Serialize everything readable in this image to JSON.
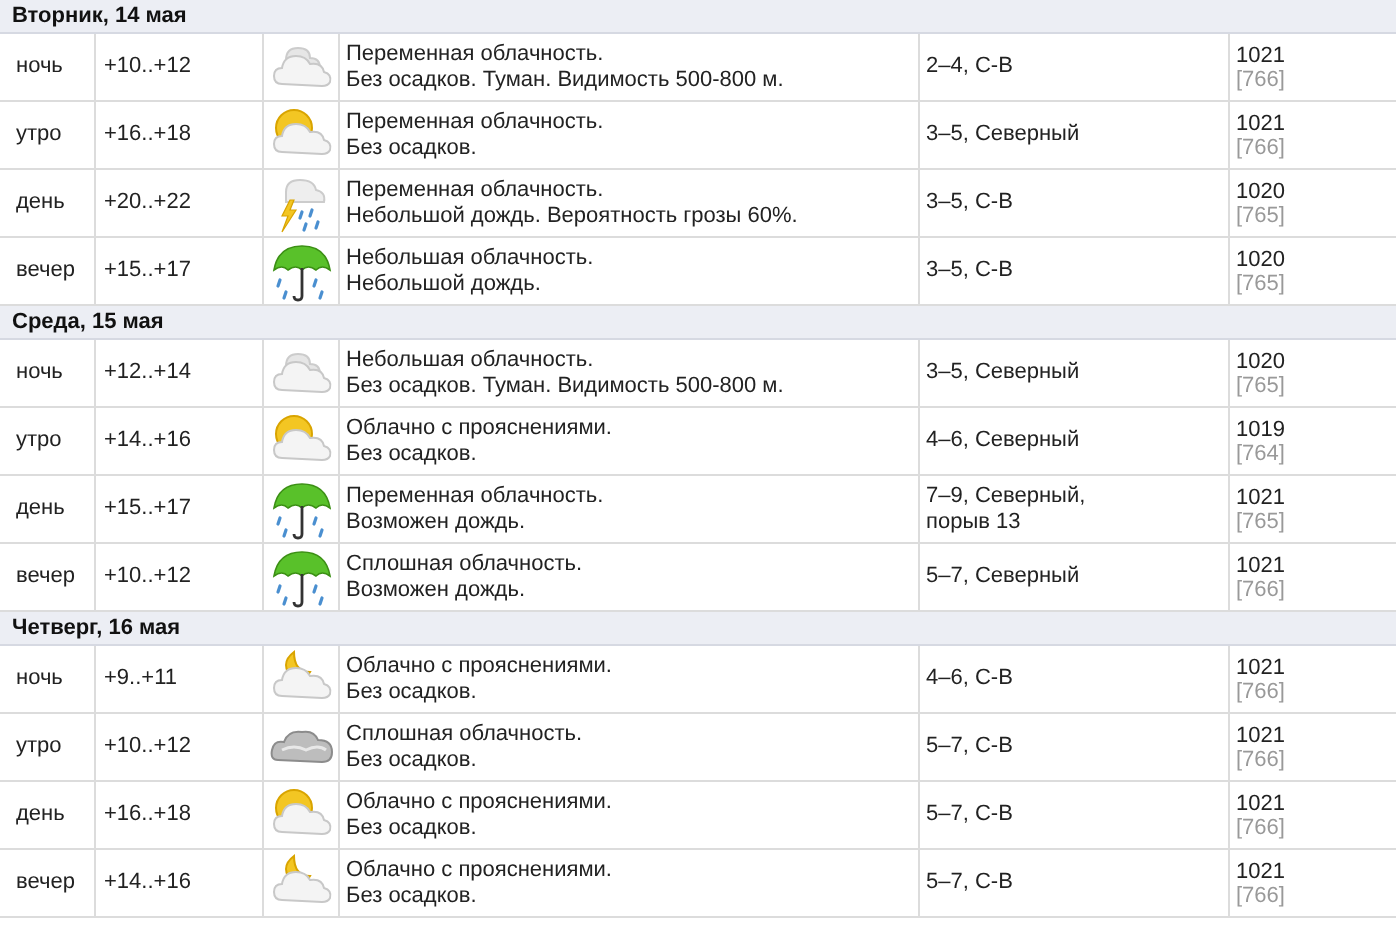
{
  "days": [
    {
      "title": "Вторник, 14 мая",
      "rows": [
        {
          "part": "ночь",
          "temp": "+10..+12",
          "kind": "cloudy",
          "cond": "Переменная облачность.",
          "precip": "Без осадков. Туман. Видимость 500-800 м.",
          "wind": "2–4, С-В",
          "pressure": "1021",
          "mmhg": "[766]"
        },
        {
          "part": "утро",
          "temp": "+16..+18",
          "kind": "sunny",
          "cond": "Переменная облачность.",
          "precip": "Без осадков.",
          "wind": "3–5, Северный",
          "pressure": "1021",
          "mmhg": "[766]"
        },
        {
          "part": "день",
          "temp": "+20..+22",
          "kind": "storm",
          "cond": "Переменная облачность.",
          "precip": "Небольшой дождь. Вероятность грозы 60%.",
          "wind": "3–5, С-В",
          "pressure": "1020",
          "mmhg": "[765]"
        },
        {
          "part": "вечер",
          "temp": "+15..+17",
          "kind": "rain",
          "cond": "Небольшая облачность.",
          "precip": "Небольшой дождь.",
          "wind": "3–5, С-В",
          "pressure": "1020",
          "mmhg": "[765]"
        }
      ]
    },
    {
      "title": "Среда, 15 мая",
      "rows": [
        {
          "part": "ночь",
          "temp": "+12..+14",
          "kind": "cloudy",
          "cond": "Небольшая облачность.",
          "precip": "Без осадков. Туман. Видимость 500-800 м.",
          "wind": "3–5, Северный",
          "pressure": "1020",
          "mmhg": "[765]"
        },
        {
          "part": "утро",
          "temp": "+14..+16",
          "kind": "sunny",
          "cond": "Облачно с прояснениями.",
          "precip": "Без осадков.",
          "wind": "4–6, Северный",
          "pressure": "1019",
          "mmhg": "[764]"
        },
        {
          "part": "день",
          "temp": "+15..+17",
          "kind": "rain",
          "cond": "Переменная облачность.",
          "precip": "Возможен дождь.",
          "wind": "7–9, Северный,",
          "gust": "порыв 13",
          "pressure": "1021",
          "mmhg": "[765]"
        },
        {
          "part": "вечер",
          "temp": "+10..+12",
          "kind": "rain",
          "cond": "Сплошная облачность.",
          "precip": "Возможен дождь.",
          "wind": "5–7, Северный",
          "pressure": "1021",
          "mmhg": "[766]"
        }
      ]
    },
    {
      "title": "Четверг, 16 мая",
      "rows": [
        {
          "part": "ночь",
          "temp": "+9..+11",
          "kind": "moon",
          "cond": "Облачно с прояснениями.",
          "precip": "Без осадков.",
          "wind": "4–6, С-В",
          "pressure": "1021",
          "mmhg": "[766]"
        },
        {
          "part": "утро",
          "temp": "+10..+12",
          "kind": "overcast",
          "cond": "Сплошная облачность.",
          "precip": "Без осадков.",
          "wind": "5–7, С-В",
          "pressure": "1021",
          "mmhg": "[766]"
        },
        {
          "part": "день",
          "temp": "+16..+18",
          "kind": "sunny",
          "cond": "Облачно с прояснениями.",
          "precip": "Без осадков.",
          "wind": "5–7, С-В",
          "pressure": "1021",
          "mmhg": "[766]"
        },
        {
          "part": "вечер",
          "temp": "+14..+16",
          "kind": "moon",
          "cond": "Облачно с прояснениями.",
          "precip": "Без осадков.",
          "wind": "5–7, С-В",
          "pressure": "1021",
          "mmhg": "[766]"
        }
      ]
    }
  ]
}
